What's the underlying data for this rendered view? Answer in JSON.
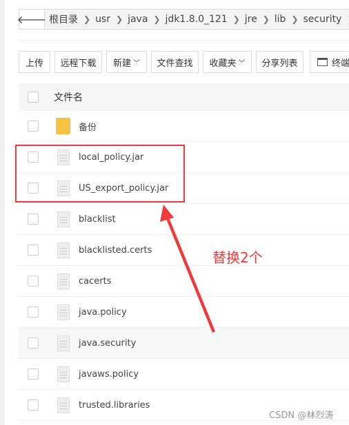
{
  "breadcrumb": {
    "back_icon": "arrow-left-icon",
    "items": [
      "根目录",
      "usr",
      "java",
      "jdk1.8.0_121",
      "jre",
      "lib",
      "security"
    ],
    "separator": ">"
  },
  "toolbar": {
    "upload": "上传",
    "remote_download": "远程下载",
    "new": "新建",
    "file_search": "文件查找",
    "favorites": "收藏夹",
    "share_list": "分享列表",
    "terminal": "终端",
    "chevron": "﹀"
  },
  "table": {
    "header": "文件名",
    "rows": [
      {
        "name": "备份",
        "type": "folder"
      },
      {
        "name": "local_policy.jar",
        "type": "file"
      },
      {
        "name": "US_export_policy.jar",
        "type": "file"
      },
      {
        "name": "blacklist",
        "type": "file"
      },
      {
        "name": "blacklisted.certs",
        "type": "file"
      },
      {
        "name": "cacerts",
        "type": "file"
      },
      {
        "name": "java.policy",
        "type": "file"
      },
      {
        "name": "java.security",
        "type": "file",
        "highlighted": true
      },
      {
        "name": "javaws.policy",
        "type": "file"
      },
      {
        "name": "trusted.libraries",
        "type": "file"
      }
    ]
  },
  "annotation": {
    "text": "替换2个",
    "color": "#f03a3a"
  },
  "watermark": "CSDN @林烈涛"
}
